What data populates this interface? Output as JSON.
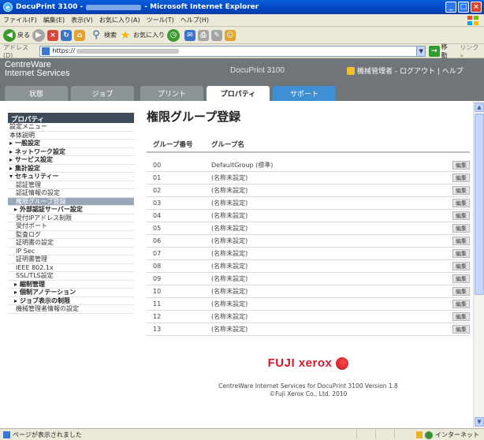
{
  "window": {
    "title_prefix": "DocuPrint 3100 -",
    "title_suffix": "- Microsoft Internet Explorer",
    "minimize_glyph": "_",
    "maximize_glyph": "□",
    "close_glyph": "×"
  },
  "menubar": {
    "items": [
      "ファイル(F)",
      "編集(E)",
      "表示(V)",
      "お気に入り(A)",
      "ツール(T)",
      "ヘルプ(H)"
    ]
  },
  "toolbar": {
    "back_label": "戻る",
    "search_label": "検索",
    "favorites_label": "お気に入り"
  },
  "addressbar": {
    "label": "アドレス(D)",
    "url_prefix": "https://",
    "go_label": "移動",
    "links_label": "リンク »"
  },
  "header": {
    "brand_line1": "CentreWare",
    "brand_line2": "Internet Services",
    "model": "DocuPrint 3100",
    "user_text": "機械管理者 - ログアウト | ヘルプ"
  },
  "tabs": [
    {
      "label": "状態"
    },
    {
      "label": "ジョブ"
    },
    {
      "label": "プリント"
    },
    {
      "label": "プロパティ"
    },
    {
      "label": "サポート"
    }
  ],
  "sidebar": {
    "heading": "プロパティ",
    "items": [
      {
        "label": "設定メニュー"
      },
      {
        "label": "本体説明"
      },
      {
        "label": "一般設定"
      },
      {
        "label": "ネットワーク設定"
      },
      {
        "label": "サービス設定"
      },
      {
        "label": "集計設定"
      },
      {
        "label": "セキュリティー"
      },
      {
        "label": "認証管理"
      },
      {
        "label": "認証情報の設定"
      },
      {
        "label": "権限グループ登録"
      },
      {
        "label": "外部認証サーバー設定"
      },
      {
        "label": "受付IPアドレス制限"
      },
      {
        "label": "受付ポート"
      },
      {
        "label": "監査ログ"
      },
      {
        "label": "証明書の設定"
      },
      {
        "label": "IP Sec"
      },
      {
        "label": "証明書管理"
      },
      {
        "label": "IEEE 802.1x"
      },
      {
        "label": "SSL/TLS設定"
      },
      {
        "label": "縮制管理"
      },
      {
        "label": "個制アノテーション"
      },
      {
        "label": "ジョブ表示の制限"
      },
      {
        "label": "機械管理者情報の設定"
      }
    ]
  },
  "main": {
    "title": "権限グループ登録",
    "col_number": "グループ番号",
    "col_name": "グループ名",
    "edit_label": "編集",
    "rows": [
      {
        "num": "00",
        "name": "DefaultGroup (標準)"
      },
      {
        "num": "01",
        "name": "(名称未設定)"
      },
      {
        "num": "02",
        "name": "(名称未設定)"
      },
      {
        "num": "03",
        "name": "(名称未設定)"
      },
      {
        "num": "04",
        "name": "(名称未設定)"
      },
      {
        "num": "05",
        "name": "(名称未設定)"
      },
      {
        "num": "06",
        "name": "(名称未設定)"
      },
      {
        "num": "07",
        "name": "(名称未設定)"
      },
      {
        "num": "08",
        "name": "(名称未設定)"
      },
      {
        "num": "09",
        "name": "(名称未設定)"
      },
      {
        "num": "10",
        "name": "(名称未設定)"
      },
      {
        "num": "11",
        "name": "(名称未設定)"
      },
      {
        "num": "12",
        "name": "(名称未設定)"
      },
      {
        "num": "13",
        "name": "(名称未設定)"
      }
    ]
  },
  "footer": {
    "logo": "FUJI xerox",
    "line1": "CentreWare Internet Services for DocuPrint 3100 Version 1.8",
    "line2": "©Fuji Xerox Co., Ltd. 2010"
  },
  "statusbar": {
    "text": "ページが表示されました",
    "zone": "インターネット"
  }
}
